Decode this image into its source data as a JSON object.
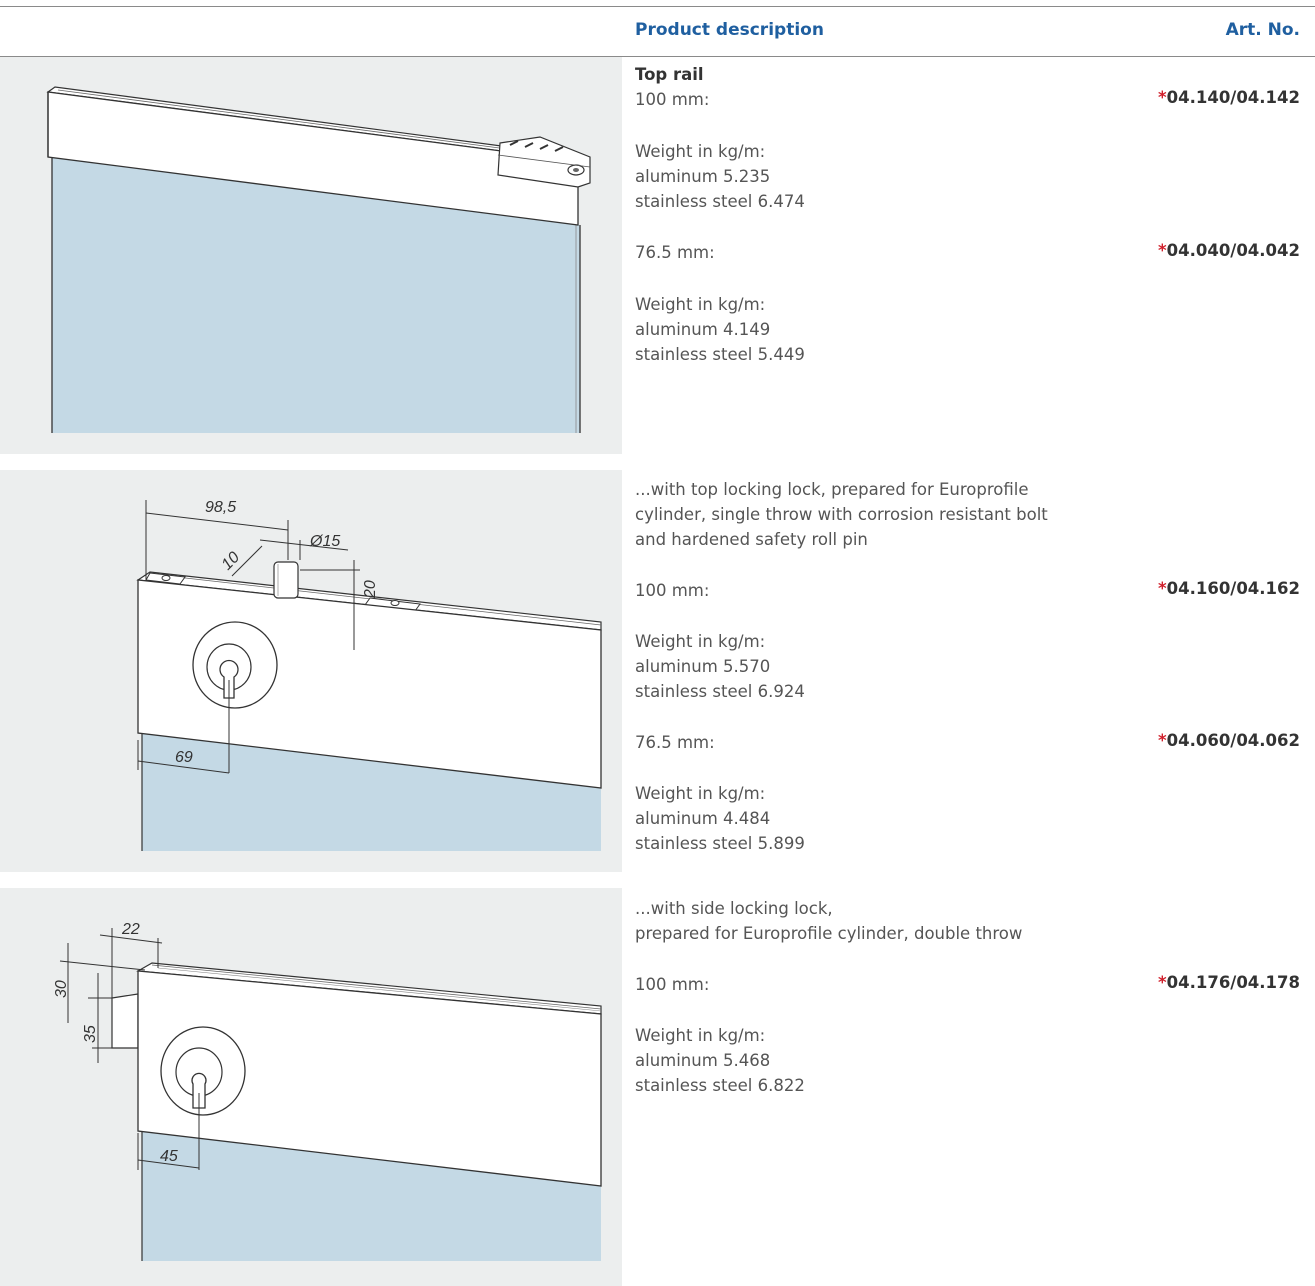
{
  "header": {
    "description_label": "Product description",
    "art_no_label": "Art. No."
  },
  "section1": {
    "title": "Top rail",
    "size_a": "100 mm:",
    "art_a": "04.140/04.142",
    "weight_label_a": "Weight in kg/m:",
    "alu_a": "aluminum 5.235",
    "steel_a": "stainless steel 6.474",
    "size_b": "76.5 mm:",
    "art_b": "04.040/04.042",
    "weight_label_b": "Weight in kg/m:",
    "alu_b": "aluminum 4.149",
    "steel_b": "stainless steel 5.449"
  },
  "section2": {
    "desc_line1": "...with top locking lock, prepared for Europrofile",
    "desc_line2": "cylinder, single throw with corrosion resistant bolt",
    "desc_line3": "and hardened safety roll pin",
    "size_a": "100 mm:",
    "art_a": "04.160/04.162",
    "weight_label_a": "Weight in kg/m:",
    "alu_a": "aluminum 5.570",
    "steel_a": "stainless steel 6.924",
    "size_b": "76.5 mm:",
    "art_b": "04.060/04.062",
    "weight_label_b": "Weight in kg/m:",
    "alu_b": "aluminum 4.484",
    "steel_b": "stainless steel 5.899",
    "dims": {
      "d1": "98,5",
      "d2": "Ø15",
      "d3": "10",
      "d4": "20",
      "d5": "69"
    }
  },
  "section3": {
    "desc_line1": "...with side locking lock,",
    "desc_line2": "prepared for Europrofile cylinder, double throw",
    "size_a": "100 mm:",
    "art_a": "04.176/04.178",
    "weight_label_a": "Weight in kg/m:",
    "alu_a": "aluminum 5.468",
    "steel_a": "stainless steel 6.822",
    "dims": {
      "d1": "22",
      "d2": "30",
      "d3": "35",
      "d4": "45"
    }
  },
  "art_marker": "*",
  "colors": {
    "accent_blue": "#1f5fa0",
    "asterisk_red": "#d0202c",
    "glass": "#c4d9e5",
    "panel_bg": "#eceeee"
  }
}
